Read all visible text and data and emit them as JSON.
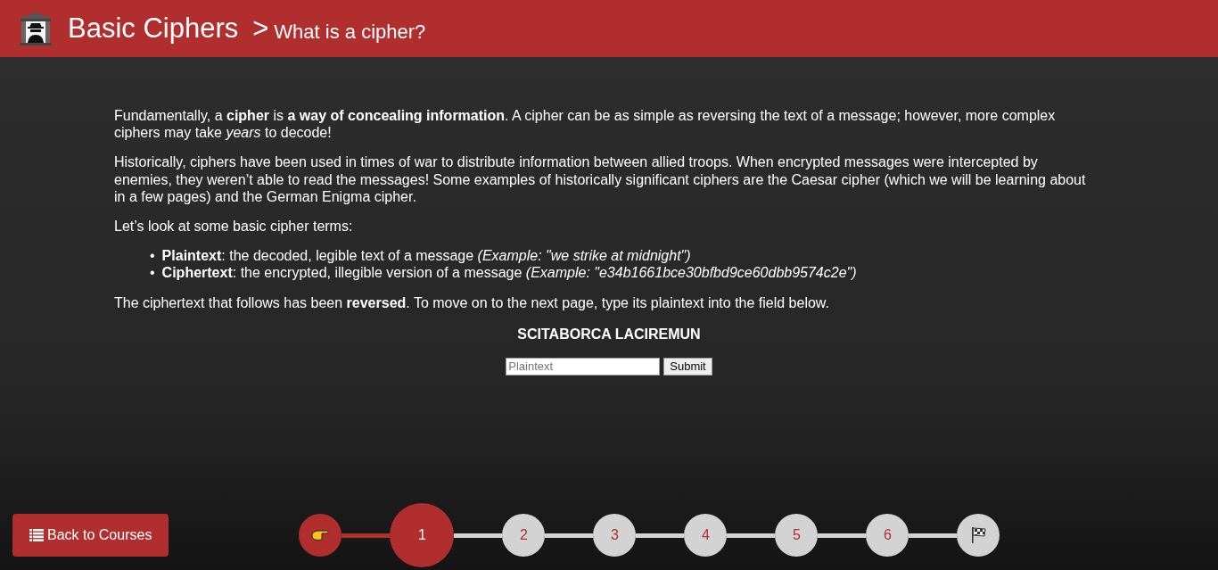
{
  "header": {
    "title": "Basic Ciphers",
    "separator": ">",
    "subtitle": "What is a cipher?"
  },
  "paragraphs": [
    "Fundamentally, a **cipher** is **a way of concealing information**. A cipher can be as simple as reversing the text of a message; however, more complex ciphers may take *years* to decode!",
    "Historically, ciphers have been used in times of war to distribute information between allied troops. When encrypted messages were intercepted by enemies, they weren’t able to read the messages! Some examples of historically significant ciphers are the Caesar cipher (which we will be learning about in a few pages) and the German Enigma cipher.",
    "Let’s look at some basic cipher terms:"
  ],
  "terms": [
    {
      "marker": "•",
      "text": "**Plaintext**: the decoded, legible text of a message *(Example: \"we strike at midnight\")*"
    },
    {
      "marker": "•",
      "text": "**Ciphertext**: the encrypted, illegible version of a message *(Example: \"e34b1661bce30bfbd9ce60dbb9574c2e\")*"
    }
  ],
  "instruction": "The ciphertext that follows has been **reversed**. To move on to the next page, type its plaintext into the field below.",
  "ciphertext": "SCITABORCA LACIREMUN",
  "answer": {
    "placeholder": "Plaintext",
    "button": "Submit"
  },
  "back_button": "Back to Courses",
  "steps": [
    {
      "kind": "start",
      "done": true,
      "selected": false
    },
    {
      "kind": "number",
      "label": "1",
      "done": true,
      "selected": true
    },
    {
      "kind": "number",
      "label": "2",
      "done": false,
      "selected": false
    },
    {
      "kind": "number",
      "label": "3",
      "done": false,
      "selected": false
    },
    {
      "kind": "number",
      "label": "4",
      "done": false,
      "selected": false
    },
    {
      "kind": "number",
      "label": "5",
      "done": false,
      "selected": false
    },
    {
      "kind": "number",
      "label": "6",
      "done": false,
      "selected": false
    },
    {
      "kind": "finish",
      "done": false,
      "selected": false
    }
  ]
}
